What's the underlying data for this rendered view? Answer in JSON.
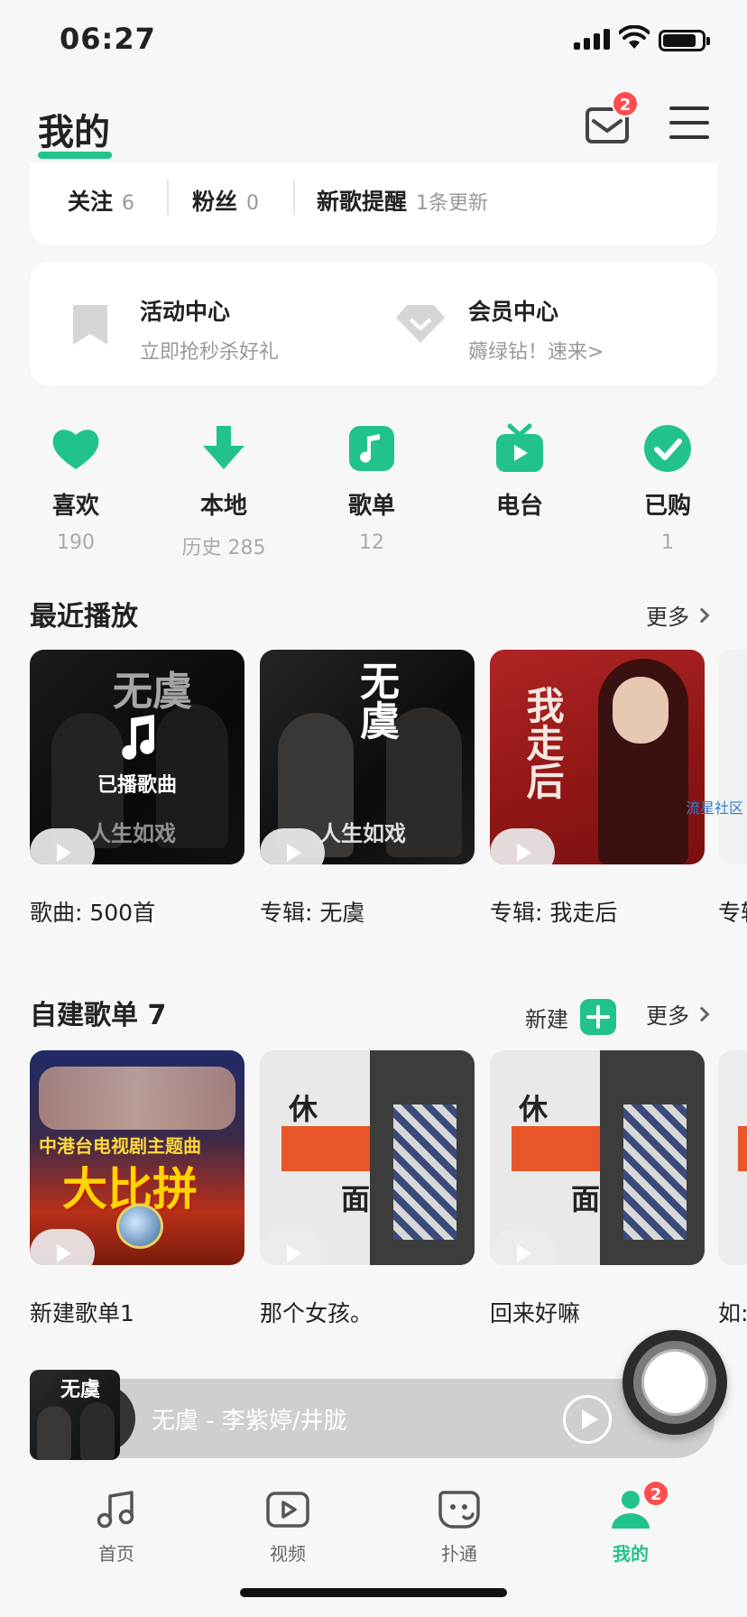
{
  "status_bar": {
    "time": "06:27"
  },
  "header": {
    "title": "我的",
    "mail_badge": "2",
    "accent": "#22c38a"
  },
  "follow_bar": {
    "follow_label": "关注",
    "follow_count": "6",
    "fans_label": "粉丝",
    "fans_count": "0",
    "newsong_label": "新歌提醒",
    "newsong_status": "1条更新"
  },
  "activity": {
    "left_title": "活动中心",
    "left_sub": "立即抢秒杀好礼",
    "right_title": "会员中心",
    "right_sub": "薅绿钻！速来>"
  },
  "quick_actions": [
    {
      "icon": "heart-icon",
      "label": "喜欢",
      "count": "190"
    },
    {
      "icon": "download-icon",
      "label": "本地",
      "count": "历史 285"
    },
    {
      "icon": "playlist-icon",
      "label": "歌单",
      "count": "12"
    },
    {
      "icon": "radio-icon",
      "label": "电台",
      "count": ""
    },
    {
      "icon": "purchased-icon",
      "label": "已购",
      "count": "1"
    }
  ],
  "recent": {
    "title": "最近播放",
    "more": "更多",
    "overlay_label": "已播歌曲",
    "items": [
      {
        "caption": "歌曲: 500首"
      },
      {
        "caption": "专辑: 无虞"
      },
      {
        "caption": "专辑: 我走后"
      },
      {
        "caption": "专辑"
      }
    ],
    "cover_text": {
      "wuyu": "无虞",
      "lyric": "人生如戏",
      "wozouhou": "我走后",
      "watermark": "流星社区"
    }
  },
  "playlists": {
    "title": "自建歌单 7",
    "new_label": "新建",
    "more": "更多",
    "items": [
      {
        "caption": "新建歌单1"
      },
      {
        "caption": "那个女孩。"
      },
      {
        "caption": "回来好嘛"
      },
      {
        "caption": "如:"
      }
    ],
    "cover_text": {
      "banner": "中港台电视剧主题曲",
      "big": "大比拼",
      "xiu": "休",
      "mian": "面"
    }
  },
  "player": {
    "now_playing": "无虞 - 李紫婷/井胧"
  },
  "tab_bar": {
    "tabs": [
      {
        "label": "首页"
      },
      {
        "label": "视频"
      },
      {
        "label": "扑通"
      },
      {
        "label": "我的"
      }
    ],
    "profile_badge": "2"
  }
}
